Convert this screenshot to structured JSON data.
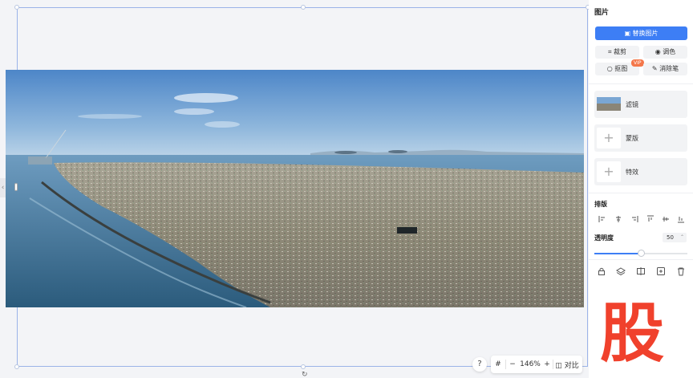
{
  "panel": {
    "title": "图片",
    "replace_label": "替换图片",
    "tools": [
      {
        "label": "裁剪",
        "icon": "crop-icon"
      },
      {
        "label": "调色",
        "icon": "palette-icon"
      },
      {
        "label": "抠图",
        "icon": "cutout-icon"
      },
      {
        "label": "消除笔",
        "icon": "eraser-icon"
      }
    ],
    "vip_badge": "VIP",
    "cards": [
      {
        "label": "滤镜",
        "icon": "filter-thumbnail"
      },
      {
        "label": "蒙版",
        "icon": "plus-icon"
      },
      {
        "label": "特效",
        "icon": "plus-icon"
      }
    ],
    "arrange_title": "排版",
    "opacity_label": "透明度",
    "opacity_value": "50",
    "opacity_fraction": 0.5,
    "watermark": "股"
  },
  "toolbar": {
    "help": "?",
    "grid": "#",
    "zoom_out": "−",
    "zoom_value": "146%",
    "zoom_in": "+",
    "compare": "对比"
  },
  "colors": {
    "accent": "#3d7ef5",
    "vip": "#f4774a",
    "watermark": "#f0412c"
  }
}
